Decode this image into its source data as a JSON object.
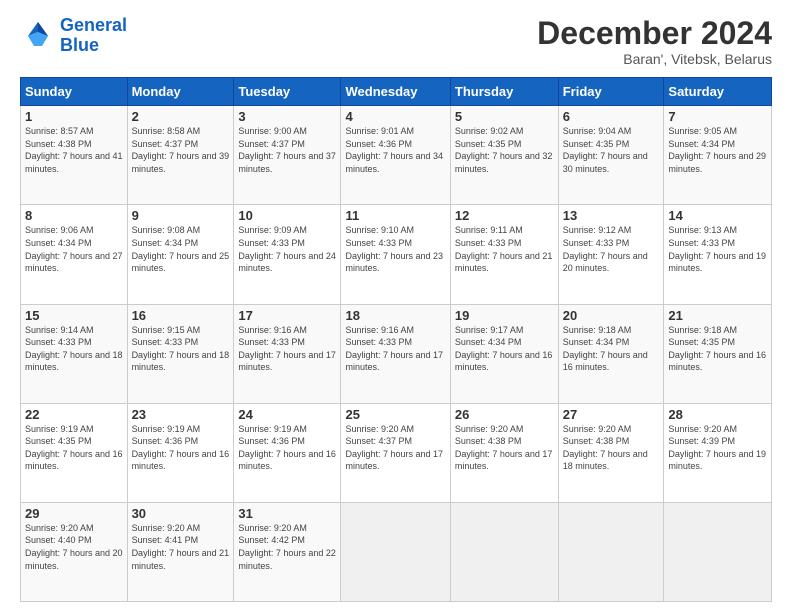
{
  "header": {
    "logo_line1": "General",
    "logo_line2": "Blue",
    "main_title": "December 2024",
    "subtitle": "Baran', Vitebsk, Belarus"
  },
  "days_of_week": [
    "Sunday",
    "Monday",
    "Tuesday",
    "Wednesday",
    "Thursday",
    "Friday",
    "Saturday"
  ],
  "weeks": [
    [
      {
        "day": "1",
        "sunrise": "8:57 AM",
        "sunset": "4:38 PM",
        "daylight": "7 hours and 41 minutes."
      },
      {
        "day": "2",
        "sunrise": "8:58 AM",
        "sunset": "4:37 PM",
        "daylight": "7 hours and 39 minutes."
      },
      {
        "day": "3",
        "sunrise": "9:00 AM",
        "sunset": "4:37 PM",
        "daylight": "7 hours and 37 minutes."
      },
      {
        "day": "4",
        "sunrise": "9:01 AM",
        "sunset": "4:36 PM",
        "daylight": "7 hours and 34 minutes."
      },
      {
        "day": "5",
        "sunrise": "9:02 AM",
        "sunset": "4:35 PM",
        "daylight": "7 hours and 32 minutes."
      },
      {
        "day": "6",
        "sunrise": "9:04 AM",
        "sunset": "4:35 PM",
        "daylight": "7 hours and 30 minutes."
      },
      {
        "day": "7",
        "sunrise": "9:05 AM",
        "sunset": "4:34 PM",
        "daylight": "7 hours and 29 minutes."
      }
    ],
    [
      {
        "day": "8",
        "sunrise": "9:06 AM",
        "sunset": "4:34 PM",
        "daylight": "7 hours and 27 minutes."
      },
      {
        "day": "9",
        "sunrise": "9:08 AM",
        "sunset": "4:34 PM",
        "daylight": "7 hours and 25 minutes."
      },
      {
        "day": "10",
        "sunrise": "9:09 AM",
        "sunset": "4:33 PM",
        "daylight": "7 hours and 24 minutes."
      },
      {
        "day": "11",
        "sunrise": "9:10 AM",
        "sunset": "4:33 PM",
        "daylight": "7 hours and 23 minutes."
      },
      {
        "day": "12",
        "sunrise": "9:11 AM",
        "sunset": "4:33 PM",
        "daylight": "7 hours and 21 minutes."
      },
      {
        "day": "13",
        "sunrise": "9:12 AM",
        "sunset": "4:33 PM",
        "daylight": "7 hours and 20 minutes."
      },
      {
        "day": "14",
        "sunrise": "9:13 AM",
        "sunset": "4:33 PM",
        "daylight": "7 hours and 19 minutes."
      }
    ],
    [
      {
        "day": "15",
        "sunrise": "9:14 AM",
        "sunset": "4:33 PM",
        "daylight": "7 hours and 18 minutes."
      },
      {
        "day": "16",
        "sunrise": "9:15 AM",
        "sunset": "4:33 PM",
        "daylight": "7 hours and 18 minutes."
      },
      {
        "day": "17",
        "sunrise": "9:16 AM",
        "sunset": "4:33 PM",
        "daylight": "7 hours and 17 minutes."
      },
      {
        "day": "18",
        "sunrise": "9:16 AM",
        "sunset": "4:33 PM",
        "daylight": "7 hours and 17 minutes."
      },
      {
        "day": "19",
        "sunrise": "9:17 AM",
        "sunset": "4:34 PM",
        "daylight": "7 hours and 16 minutes."
      },
      {
        "day": "20",
        "sunrise": "9:18 AM",
        "sunset": "4:34 PM",
        "daylight": "7 hours and 16 minutes."
      },
      {
        "day": "21",
        "sunrise": "9:18 AM",
        "sunset": "4:35 PM",
        "daylight": "7 hours and 16 minutes."
      }
    ],
    [
      {
        "day": "22",
        "sunrise": "9:19 AM",
        "sunset": "4:35 PM",
        "daylight": "7 hours and 16 minutes."
      },
      {
        "day": "23",
        "sunrise": "9:19 AM",
        "sunset": "4:36 PM",
        "daylight": "7 hours and 16 minutes."
      },
      {
        "day": "24",
        "sunrise": "9:19 AM",
        "sunset": "4:36 PM",
        "daylight": "7 hours and 16 minutes."
      },
      {
        "day": "25",
        "sunrise": "9:20 AM",
        "sunset": "4:37 PM",
        "daylight": "7 hours and 17 minutes."
      },
      {
        "day": "26",
        "sunrise": "9:20 AM",
        "sunset": "4:38 PM",
        "daylight": "7 hours and 17 minutes."
      },
      {
        "day": "27",
        "sunrise": "9:20 AM",
        "sunset": "4:38 PM",
        "daylight": "7 hours and 18 minutes."
      },
      {
        "day": "28",
        "sunrise": "9:20 AM",
        "sunset": "4:39 PM",
        "daylight": "7 hours and 19 minutes."
      }
    ],
    [
      {
        "day": "29",
        "sunrise": "9:20 AM",
        "sunset": "4:40 PM",
        "daylight": "7 hours and 20 minutes."
      },
      {
        "day": "30",
        "sunrise": "9:20 AM",
        "sunset": "4:41 PM",
        "daylight": "7 hours and 21 minutes."
      },
      {
        "day": "31",
        "sunrise": "9:20 AM",
        "sunset": "4:42 PM",
        "daylight": "7 hours and 22 minutes."
      },
      null,
      null,
      null,
      null
    ]
  ]
}
